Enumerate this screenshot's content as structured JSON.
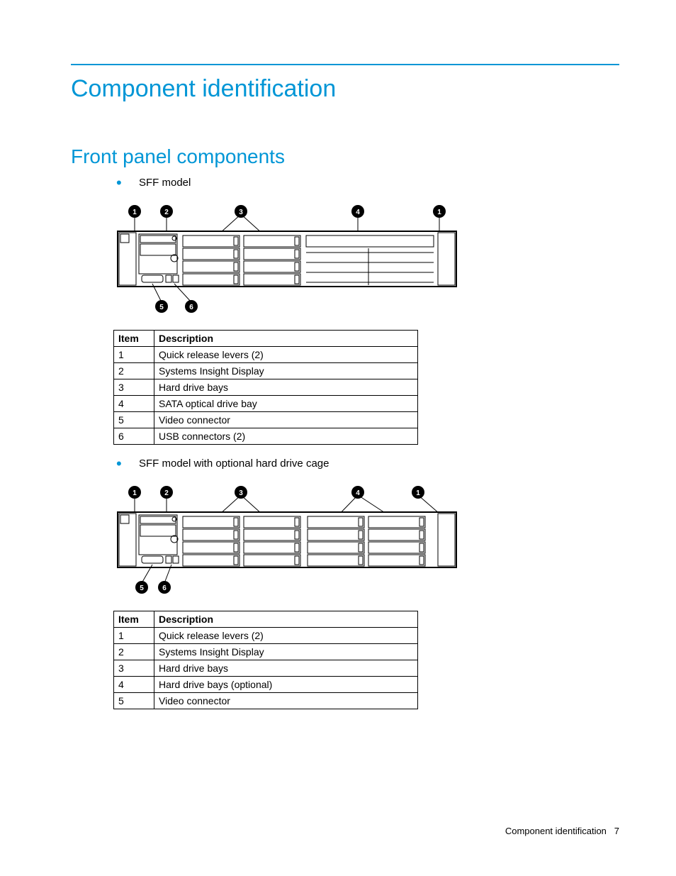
{
  "page": {
    "title": "Component identification",
    "subtitle": "Front panel components"
  },
  "sections": [
    {
      "bullet": "SFF model",
      "table": {
        "headers": {
          "item": "Item",
          "desc": "Description"
        },
        "rows": [
          {
            "item": "1",
            "desc": "Quick release levers (2)"
          },
          {
            "item": "2",
            "desc": "Systems Insight Display"
          },
          {
            "item": "3",
            "desc": "Hard drive bays"
          },
          {
            "item": "4",
            "desc": "SATA optical drive bay"
          },
          {
            "item": "5",
            "desc": "Video connector"
          },
          {
            "item": "6",
            "desc": "USB connectors (2)"
          }
        ]
      }
    },
    {
      "bullet": "SFF model with optional hard drive cage",
      "table": {
        "headers": {
          "item": "Item",
          "desc": "Description"
        },
        "rows": [
          {
            "item": "1",
            "desc": "Quick release levers (2)"
          },
          {
            "item": "2",
            "desc": "Systems Insight Display"
          },
          {
            "item": "3",
            "desc": "Hard drive bays"
          },
          {
            "item": "4",
            "desc": "Hard drive bays (optional)"
          },
          {
            "item": "5",
            "desc": "Video connector"
          }
        ]
      }
    }
  ],
  "footer": {
    "section": "Component identification",
    "page_num": "7"
  }
}
